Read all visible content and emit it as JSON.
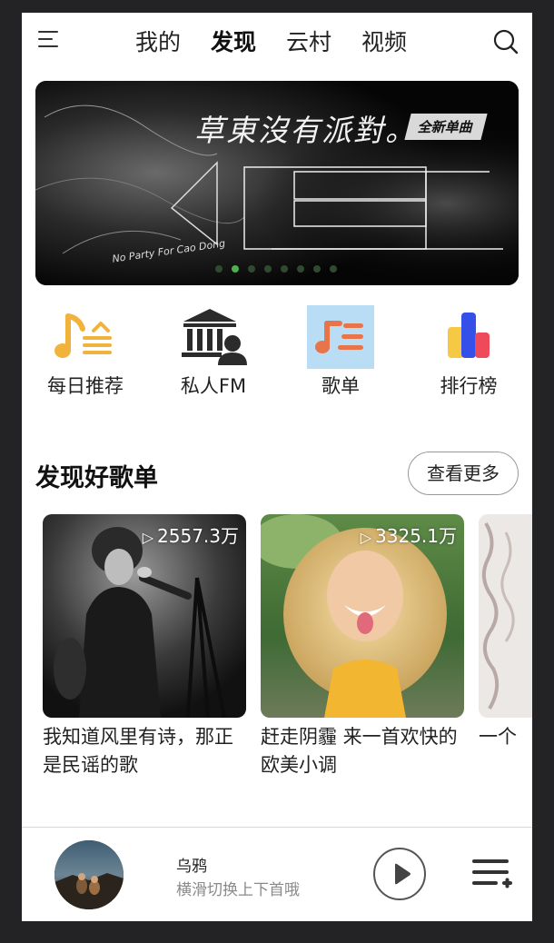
{
  "nav": {
    "tabs": [
      {
        "label": "我的",
        "active": false
      },
      {
        "label": "发现",
        "active": true
      },
      {
        "label": "云村",
        "active": false
      },
      {
        "label": "视频",
        "active": false
      }
    ],
    "menu_icon": "hamburger-icon",
    "search_icon": "search-icon"
  },
  "banner": {
    "title": "草東沒有派對。",
    "tag": "全新单曲",
    "subtitle": "No Party For Cao Dong",
    "dot_count": 8,
    "active_dot": 1
  },
  "entries": [
    {
      "label": "每日推荐",
      "icon": "daily-music-icon",
      "color": "#F2B33D"
    },
    {
      "label": "私人FM",
      "icon": "personal-fm-icon",
      "color": "#2B2B2B"
    },
    {
      "label": "歌单",
      "icon": "playlist-icon",
      "color": "#E8754A"
    },
    {
      "label": "排行榜",
      "icon": "chart-icon",
      "color": "#3550E8"
    }
  ],
  "section": {
    "title": "发现好歌单",
    "more_label": "查看更多"
  },
  "playlists": [
    {
      "plays": "2557.3万",
      "name": "我知道风里有诗，那正是民谣的歌"
    },
    {
      "plays": "3325.1万",
      "name": "赶走阴霾 来一首欢快的欧美小调"
    },
    {
      "plays": "",
      "name": "一个"
    }
  ],
  "player": {
    "song": "乌鸦",
    "hint": "横滑切换上下首哦",
    "play_icon": "play-icon",
    "queue_icon": "playlist-queue-icon"
  },
  "colors": {
    "accent": "#4CAF50",
    "background": "#232325"
  }
}
